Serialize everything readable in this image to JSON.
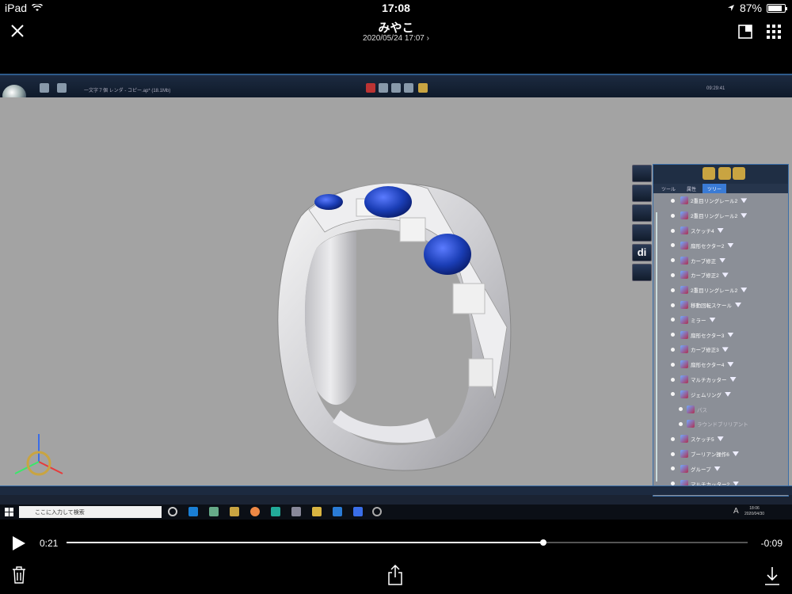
{
  "statusbar": {
    "device": "iPad",
    "time": "17:08",
    "battery": "87%",
    "battery_level": 0.87
  },
  "header": {
    "title": "みやこ",
    "subtitle": "2020/05/24 17:07 ›"
  },
  "video": {
    "app_title": "一文字７個 レンダ - コピー.ap* (18.1Mb)",
    "app_time": "09:29:41",
    "side_tools": [
      "",
      "",
      "",
      "",
      "di",
      ""
    ],
    "panel_tabs": [
      "ツール",
      "属性",
      "ツリー"
    ],
    "tree_items": [
      {
        "label": "2重目リングレール2",
        "child": false,
        "dim": false
      },
      {
        "label": "2重目リングレール2",
        "child": false,
        "dim": false
      },
      {
        "label": "スケッチ4",
        "child": false,
        "dim": false
      },
      {
        "label": "扇形セクター2",
        "child": false,
        "dim": false
      },
      {
        "label": "カーブ修正",
        "child": false,
        "dim": false
      },
      {
        "label": "カーブ修正2",
        "child": false,
        "dim": false
      },
      {
        "label": "2重目リングレール2",
        "child": false,
        "dim": false
      },
      {
        "label": "移動回転スケール",
        "child": false,
        "dim": false
      },
      {
        "label": "ミラー",
        "child": false,
        "dim": false
      },
      {
        "label": "扇形セクター3",
        "child": false,
        "dim": false
      },
      {
        "label": "カーブ修正3",
        "child": false,
        "dim": false
      },
      {
        "label": "扇形セクター4",
        "child": false,
        "dim": false
      },
      {
        "label": "マルチカッター",
        "child": false,
        "dim": false
      },
      {
        "label": "ジェムリング",
        "child": false,
        "dim": false
      },
      {
        "label": "パス",
        "child": true,
        "dim": true
      },
      {
        "label": "ラウンドブリリアント",
        "child": true,
        "dim": true
      },
      {
        "label": "スケッチ5",
        "child": false,
        "dim": false
      },
      {
        "label": "ブーリアン操作6",
        "child": false,
        "dim": false
      },
      {
        "label": "グループ",
        "child": false,
        "dim": false
      },
      {
        "label": "マルチカッター2",
        "child": false,
        "dim": false
      }
    ],
    "watermark": "3DESIGN",
    "taskbar": {
      "search_placeholder": "ここに入力して検索",
      "ime": "A",
      "clock_time": "18:06",
      "clock_date": "2020/04/30"
    }
  },
  "playback": {
    "current": "0:21",
    "remaining": "-0:09",
    "progress": 0.7
  },
  "colors": {
    "accent": "#3a7bd5",
    "viewport": "#a3a3a3",
    "gem_blue": "#1a3db5"
  }
}
